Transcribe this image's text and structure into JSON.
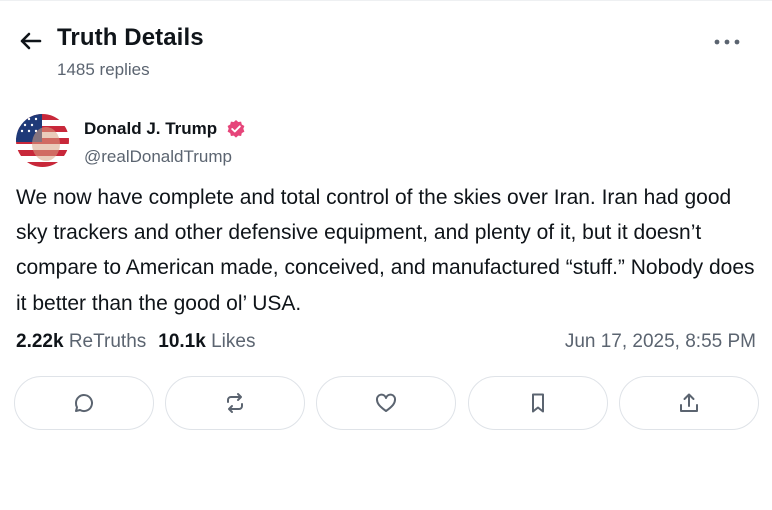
{
  "header": {
    "title": "Truth Details",
    "replies": "1485 replies",
    "back_icon": "arrow-left-icon",
    "more_icon": "more-horizontal-icon"
  },
  "post": {
    "author_name": "Donald J. Trump",
    "verified_icon": "verified-badge-icon",
    "handle": "@realDonaldTrump",
    "text": "We now have complete and total control of the skies over Iran. Iran had good sky trackers and other defensive equipment, and plenty of it, but it doesn’t compare to American made, conceived, and manufactured “stuff.”  Nobody does it better than the good ol’ USA.",
    "retruths_count": "2.22k",
    "retruths_label": "ReTruths",
    "likes_count": "10.1k",
    "likes_label": "Likes",
    "timestamp": "Jun 17, 2025, 8:55 PM"
  },
  "actions": [
    {
      "icon": "reply-icon"
    },
    {
      "icon": "retruth-icon"
    },
    {
      "icon": "like-heart-icon"
    },
    {
      "icon": "bookmark-icon"
    },
    {
      "icon": "share-icon"
    }
  ],
  "colors": {
    "text": "#0f1419",
    "muted": "#5b6470",
    "border": "#dfe3e8",
    "verified": "#e6457a"
  }
}
